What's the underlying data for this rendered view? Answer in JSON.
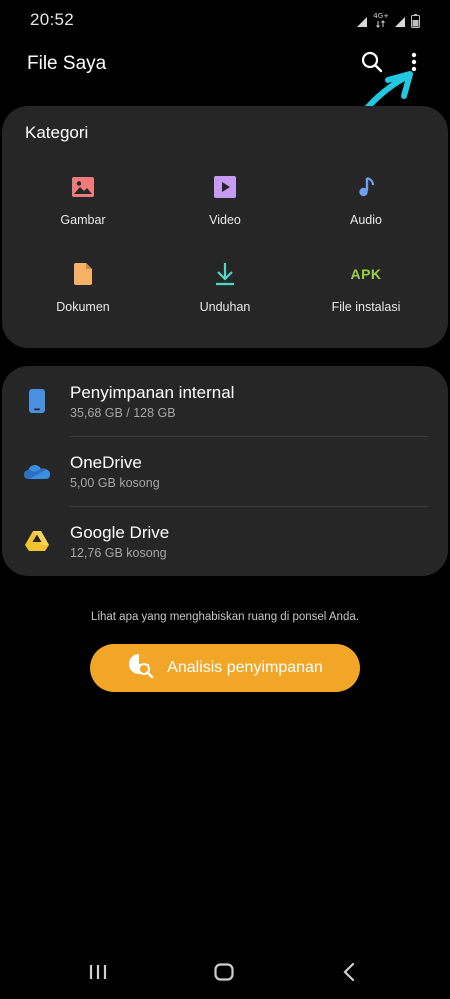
{
  "status_bar": {
    "time": "20:52",
    "network_label": "4G+",
    "icons": [
      "signal-icon",
      "network-4g-icon",
      "signal-icon",
      "battery-icon"
    ]
  },
  "app_bar": {
    "title": "File Saya",
    "icons": [
      "search-icon",
      "more-options-icon"
    ]
  },
  "categories": {
    "title": "Kategori",
    "items": [
      {
        "label": "Gambar",
        "icon": "image-icon",
        "color": "#ee7c7c"
      },
      {
        "label": "Video",
        "icon": "video-icon",
        "color": "#c79bf2"
      },
      {
        "label": "Audio",
        "icon": "audio-icon",
        "color": "#6f9ff0"
      },
      {
        "label": "Dokumen",
        "icon": "document-icon",
        "color": "#f5b267"
      },
      {
        "label": "Unduhan",
        "icon": "download-icon",
        "color": "#4ed6c9"
      },
      {
        "label": "File instalasi",
        "icon": "apk-icon",
        "icon_text": "APK",
        "color": "#9bd143"
      }
    ]
  },
  "storage": {
    "items": [
      {
        "name": "Penyimpanan internal",
        "detail": "35,68 GB / 128 GB",
        "icon": "phone-icon",
        "color": "#4a90e2"
      },
      {
        "name": "OneDrive",
        "detail": "5,00 GB kosong",
        "icon": "onedrive-icon",
        "color": "#3a8fe0"
      },
      {
        "name": "Google Drive",
        "detail": "12,76 GB kosong",
        "icon": "google-drive-icon",
        "color": "#f1c232"
      }
    ]
  },
  "analysis": {
    "hint": "Lihat apa yang menghabiskan ruang di ponsel Anda.",
    "button_label": "Analisis penyimpanan",
    "button_icon": "storage-analysis-icon",
    "button_color": "#f2a627"
  },
  "nav_bar": {
    "icons": [
      "recent-apps-icon",
      "home-icon",
      "back-icon"
    ]
  },
  "annotation": {
    "icon": "hand-drawn-arrow-icon",
    "color": "#21c9e0"
  }
}
